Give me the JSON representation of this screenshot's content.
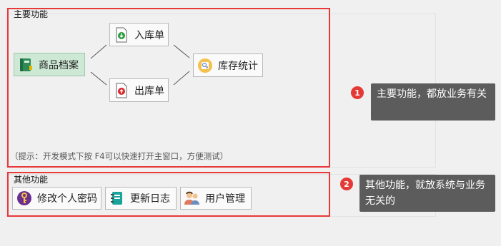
{
  "main_group": {
    "title": "主要功能",
    "buttons": {
      "product": "商品档案",
      "inbound": "入库单",
      "outbound": "出库单",
      "stock": "库存统计"
    },
    "hint": "（提示：开发模式下按 F4可以快速打开主窗口，方便测试）"
  },
  "other_group": {
    "title": "其他功能",
    "buttons": {
      "password": "修改个人密码",
      "changelog": "更新日志",
      "users": "用户管理"
    }
  },
  "annotations": [
    {
      "number": "1",
      "text": "主要功能，都放业务有关"
    },
    {
      "number": "2",
      "text": "其他功能，就放系统与业务无关的"
    }
  ],
  "colors": {
    "frame": "#e8383a",
    "callout": "#5c5c5c",
    "badge": "#e53935",
    "selected": "#cde8d4"
  }
}
